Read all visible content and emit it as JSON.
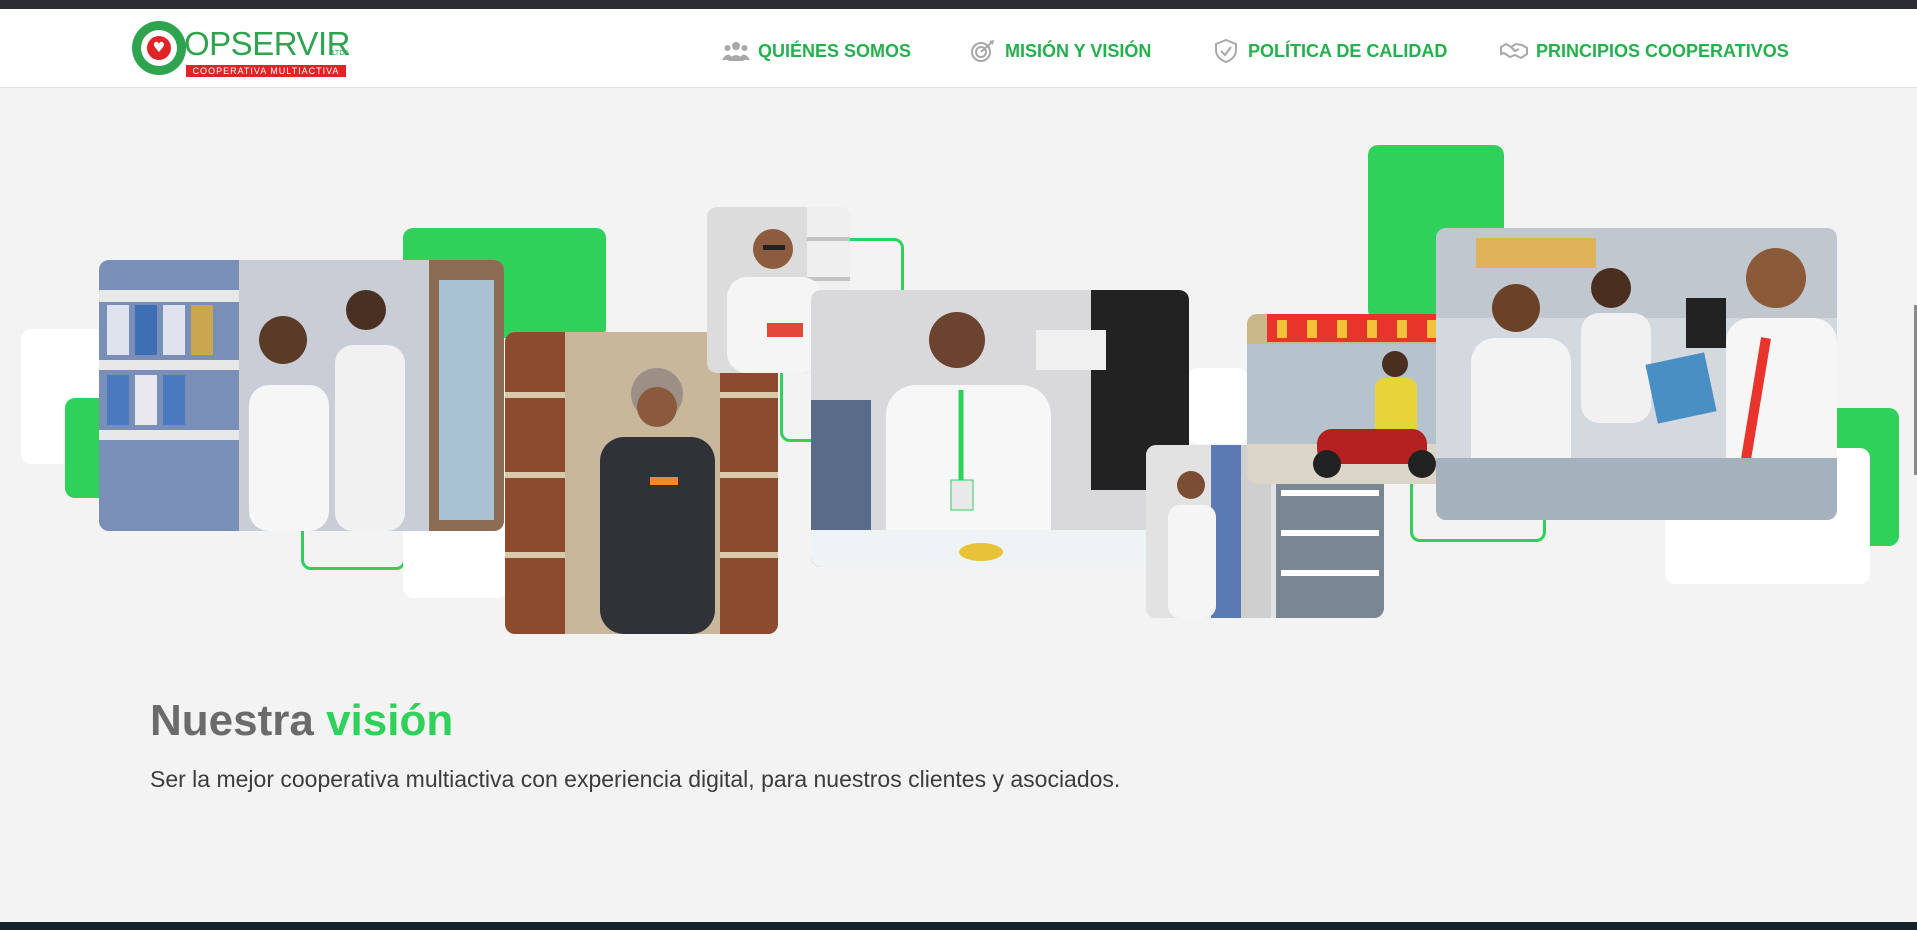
{
  "logo": {
    "brand": "OPSERVIR",
    "suffix": "LTDA",
    "tagline": "COOPERATIVA MULTIACTIVA"
  },
  "nav": [
    {
      "label": "QUIÉNES SOMOS",
      "icon": "people-icon"
    },
    {
      "label": "MISIÓN Y VISIÓN",
      "icon": "target-icon"
    },
    {
      "label": "POLÍTICA DE CALIDAD",
      "icon": "shield-icon"
    },
    {
      "label": "PRINCIPIOS COOPERATIVOS",
      "icon": "handshake-icon"
    }
  ],
  "vision": {
    "title_part1": "Nuestra",
    "title_part2": "visión",
    "text": "Ser la mejor cooperativa multiactiva con experiencia digital, para nuestros clientes y asociados."
  },
  "colors": {
    "accent": "#2fd15a",
    "nav_text": "#22b14c",
    "logo_red": "#e02327",
    "title_gray": "#6b6b6b"
  }
}
